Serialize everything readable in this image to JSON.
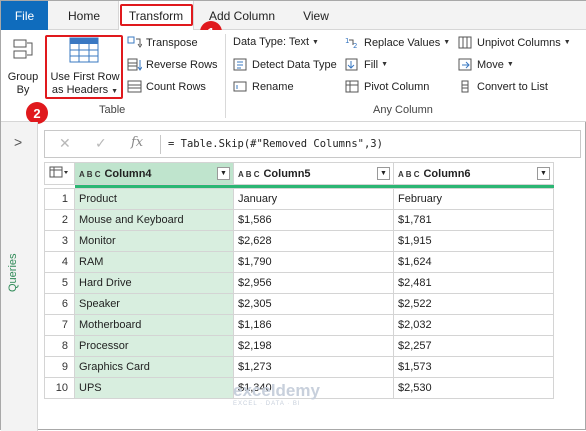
{
  "tabs": {
    "file": "File",
    "home": "Home",
    "transform": "Transform",
    "add_column": "Add Column",
    "view": "View"
  },
  "callouts": {
    "one": "1",
    "two": "2"
  },
  "ribbon": {
    "group_by": [
      "Group",
      "By"
    ],
    "use_first_row": [
      "Use First Row",
      "as Headers"
    ],
    "transpose": "Transpose",
    "reverse_rows": "Reverse Rows",
    "count_rows": "Count Rows",
    "table_group": "Table",
    "data_type": "Data Type: Text",
    "detect_type": "Detect Data Type",
    "rename": "Rename",
    "replace_values": "Replace Values",
    "fill": "Fill",
    "pivot_column": "Pivot Column",
    "unpivot_columns": "Unpivot Columns",
    "move": "Move",
    "convert_to_list": "Convert to List",
    "any_column_group": "Any Column"
  },
  "left_pane": {
    "title": "Queries",
    "expand": ">"
  },
  "formula_bar": {
    "cancel": "✕",
    "commit": "✓",
    "fx": "fx",
    "formula": "= Table.Skip(#\"Removed Columns\",3)"
  },
  "grid": {
    "type_label": "A B C",
    "columns": [
      "Column4",
      "Column5",
      "Column6"
    ],
    "rows": [
      [
        "1",
        "Product",
        "January",
        "February"
      ],
      [
        "2",
        "Mouse and Keyboard",
        "$1,586",
        "$1,781"
      ],
      [
        "3",
        "Monitor",
        "$2,628",
        "$1,915"
      ],
      [
        "4",
        "RAM",
        "$1,790",
        "$1,624"
      ],
      [
        "5",
        "Hard Drive",
        "$2,956",
        "$2,481"
      ],
      [
        "6",
        "Speaker",
        "$2,305",
        "$2,522"
      ],
      [
        "7",
        "Motherboard",
        "$1,186",
        "$2,032"
      ],
      [
        "8",
        "Processor",
        "$2,198",
        "$2,257"
      ],
      [
        "9",
        "Graphics Card",
        "$1,273",
        "$1,573"
      ],
      [
        "10",
        "UPS",
        "$1,340",
        "$2,530"
      ]
    ]
  },
  "watermark": {
    "name": "exceldemy",
    "tagline": "EXCEL · DATA · BI"
  },
  "colors": {
    "accent": "#0f6cbd",
    "callout": "#e0191d",
    "selected_column": "#d8eedf",
    "quality_bar": "#2bb673"
  }
}
